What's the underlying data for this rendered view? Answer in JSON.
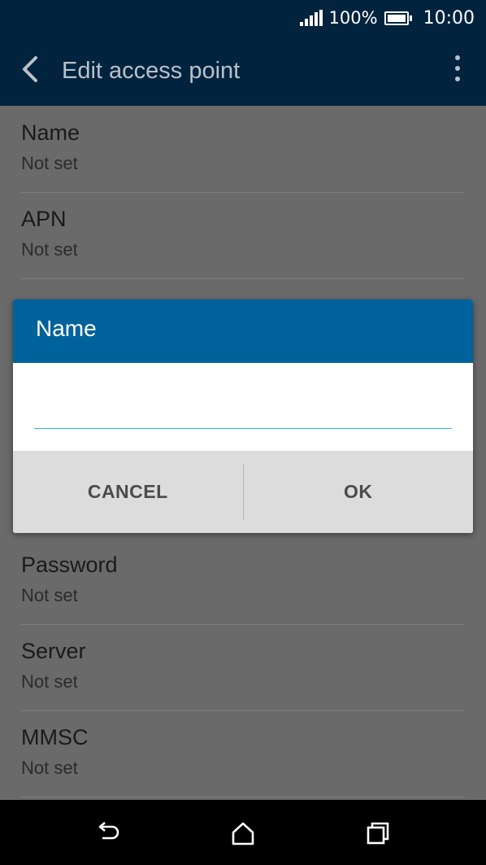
{
  "status_bar": {
    "battery_percent": "100%",
    "time": "10:00",
    "icons": [
      "signal-icon",
      "battery-icon"
    ]
  },
  "app_bar": {
    "title": "Edit access point",
    "icons": [
      "back-arrow-icon",
      "more-vert-icon"
    ]
  },
  "list": {
    "items": [
      {
        "title": "Name",
        "value": "Not set"
      },
      {
        "title": "APN",
        "value": "Not set"
      },
      {
        "title": "Password",
        "value": "Not set"
      },
      {
        "title": "Server",
        "value": "Not set"
      },
      {
        "title": "MMSC",
        "value": "Not set"
      }
    ]
  },
  "dialog": {
    "title": "Name",
    "input_value": "",
    "cancel_label": "CANCEL",
    "ok_label": "OK",
    "colors": {
      "header": "#00629a",
      "input_underline": "#2ab7d3"
    }
  },
  "nav_bar": {
    "icons": [
      "back-icon",
      "home-icon",
      "recents-icon"
    ]
  },
  "colors": {
    "app_bar": "#01233d",
    "scrim": "#6a6a6a"
  }
}
